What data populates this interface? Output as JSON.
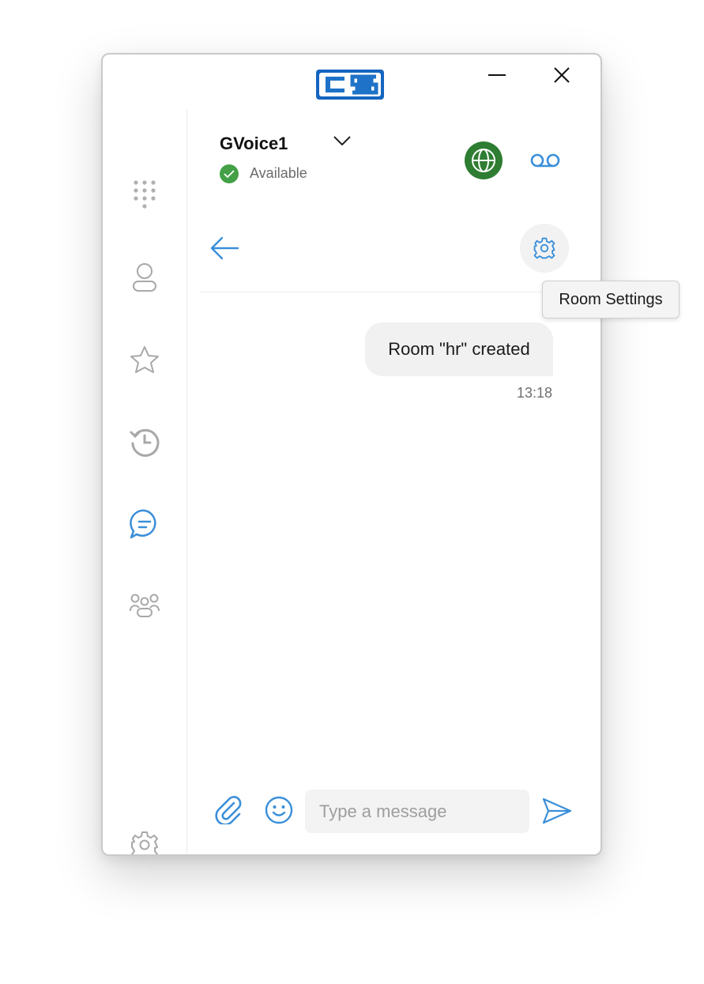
{
  "window": {
    "logo": "CC logo"
  },
  "sidebar": {
    "items": [
      {
        "name": "dialpad",
        "icon": "dialpad-icon"
      },
      {
        "name": "contacts",
        "icon": "person-icon"
      },
      {
        "name": "favorites",
        "icon": "star-icon"
      },
      {
        "name": "history",
        "icon": "history-icon"
      },
      {
        "name": "chat",
        "icon": "chat-icon",
        "active": true
      },
      {
        "name": "groups",
        "icon": "group-icon"
      },
      {
        "name": "settings",
        "icon": "gear-icon"
      }
    ]
  },
  "account": {
    "name": "GVoice1",
    "status": "Available",
    "status_color": "#43a047"
  },
  "chat": {
    "messages": [
      {
        "text": "Room \"hr\" created",
        "time": "13:18"
      }
    ]
  },
  "composer": {
    "placeholder": "Type a message",
    "value": ""
  },
  "tooltip": {
    "text": "Room Settings"
  },
  "colors": {
    "accent": "#3a8fd9",
    "globe_bg": "#2e7d32",
    "icon_gray": "#9e9e9e"
  }
}
